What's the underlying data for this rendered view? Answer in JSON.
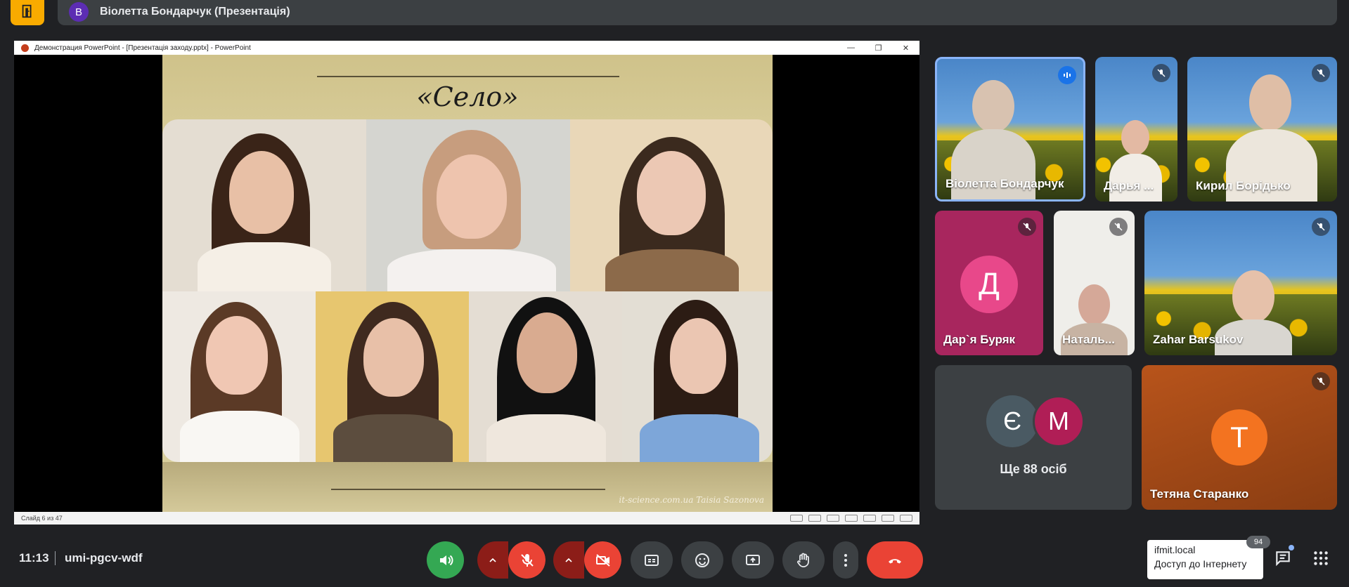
{
  "topbar": {
    "presenter_avatar_letter": "В",
    "presenter_label": "Віолетта Бондарчук (Презентація)"
  },
  "presentation": {
    "window_title": "Демонстрация PowerPoint - [Презентація заходу.pptx] - PowerPoint",
    "window_controls": [
      "—",
      "❐",
      "✕"
    ],
    "slide_counter": "Слайд 6 из 47",
    "slide_title": "«Село»",
    "slide_credit": "it-science.com.ua  Taisia Sazonova"
  },
  "participants": [
    {
      "name": "Віолетта Бондарчук",
      "mic": "speaking"
    },
    {
      "name": "Дарья ...",
      "mic": "muted"
    },
    {
      "name": "Кирил Борідько",
      "mic": "muted"
    },
    {
      "name": "Дар`я Буряк",
      "initial": "Д",
      "mic": "muted",
      "color": "#e8488a"
    },
    {
      "name": "Наталь...",
      "mic": "muted"
    },
    {
      "name": "Zahar Barsukov",
      "mic": "muted"
    },
    {
      "name": "Ще 88 осіб",
      "initials": [
        "Є",
        "М"
      ]
    },
    {
      "name": "Тетяна Старанко",
      "initial": "Т",
      "mic": "muted",
      "color": "#f37320"
    }
  ],
  "bottombar": {
    "clock": "11:13",
    "meeting_code": "umi-pgcv-wdf",
    "buttons": [
      "audio-output",
      "mic-toggle",
      "camera-toggle",
      "captions",
      "emoji",
      "present",
      "raise-hand",
      "more-options",
      "leave-call"
    ],
    "tooltip_line1": "ifmit.local",
    "tooltip_line2": "Доступ до Інтернету",
    "chat_badge": "94"
  },
  "colors": {
    "background": "#202124",
    "danger": "#ea4335",
    "active_green": "#34a853",
    "accent_blue": "#8ab4f8"
  }
}
